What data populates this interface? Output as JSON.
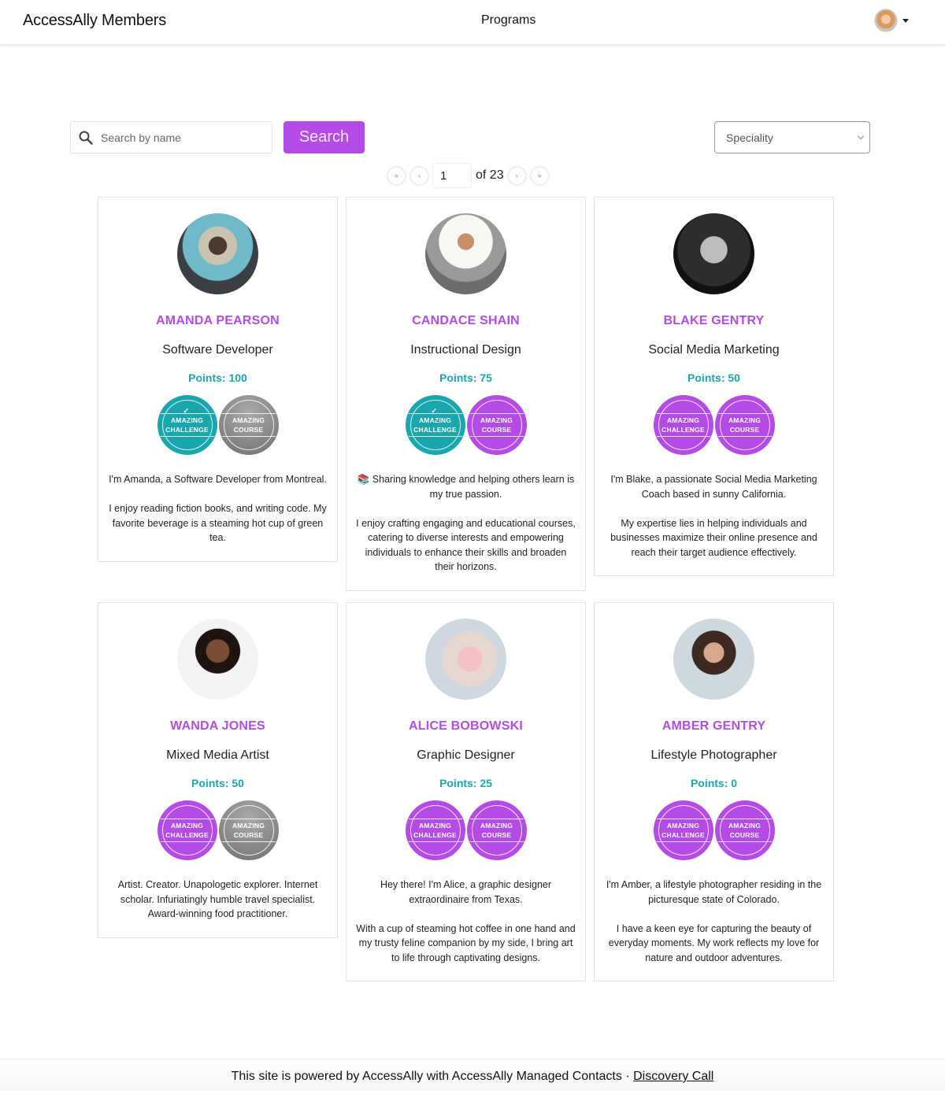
{
  "header": {
    "brand": "AccessAlly Members",
    "nav_programs": "Programs",
    "user_menu_icon": "user-avatar-dropdown"
  },
  "toolbar": {
    "search_placeholder": "Search by name",
    "search_value": "",
    "search_button": "Search",
    "speciality_selected": "Speciality"
  },
  "pagination": {
    "first_label": "«",
    "prev_label": "‹",
    "current_page": "1",
    "of_text": "of 23",
    "next_label": "›",
    "last_label": "»"
  },
  "colors": {
    "accent_purple": "#b44be6",
    "points_teal": "#1aa6ad",
    "badge_teal": "#1aa6ad",
    "badge_gray": "#8a8a8a"
  },
  "members": [
    {
      "name": "AMANDA PEARSON",
      "title": "Software Developer",
      "points": "Points: 100",
      "badges": [
        {
          "line1": "AMAZING",
          "line2": "CHALLENGE",
          "state": "completed",
          "check": "✓"
        },
        {
          "line1": "AMAZING",
          "line2": "COURSE",
          "state": "locked",
          "check": ""
        }
      ],
      "bio": [
        "I'm Amanda, a Software Developer from Montreal.",
        "I enjoy reading fiction books, and writing code. My favorite beverage is a steaming hot cup of green tea."
      ]
    },
    {
      "name": "CANDACE SHAIN",
      "title": "Instructional Design",
      "points": "Points: 75",
      "badges": [
        {
          "line1": "AMAZING",
          "line2": "CHALLENGE",
          "state": "completed",
          "check": "✓"
        },
        {
          "line1": "AMAZING",
          "line2": "COURSE",
          "state": "available",
          "check": ""
        }
      ],
      "bio": [
        "📚 Sharing knowledge and helping others learn is my true passion.",
        "I enjoy crafting engaging and educational courses, catering to diverse interests and empowering individuals to enhance their skills and broaden their horizons."
      ]
    },
    {
      "name": "BLAKE GENTRY",
      "title": "Social Media Marketing",
      "points": "Points: 50",
      "badges": [
        {
          "line1": "AMAZING",
          "line2": "CHALLENGE",
          "state": "available",
          "check": ""
        },
        {
          "line1": "AMAZING",
          "line2": "COURSE",
          "state": "available",
          "check": ""
        }
      ],
      "bio": [
        "I'm Blake, a passionate Social Media Marketing Coach based in sunny California.",
        "My expertise lies in helping individuals and businesses maximize their online presence and reach their target audience effectively."
      ]
    },
    {
      "name": "WANDA JONES",
      "title": "Mixed Media Artist",
      "points": "Points: 50",
      "badges": [
        {
          "line1": "AMAZING",
          "line2": "CHALLENGE",
          "state": "available",
          "check": ""
        },
        {
          "line1": "AMAZING",
          "line2": "COURSE",
          "state": "locked",
          "check": ""
        }
      ],
      "bio": [
        "Artist. Creator. Unapologetic explorer. Internet scholar. Infuriatingly humble travel specialist. Award-winning food practitioner."
      ]
    },
    {
      "name": "ALICE BOBOWSKI",
      "title": "Graphic Designer",
      "points": "Points: 25",
      "badges": [
        {
          "line1": "AMAZING",
          "line2": "CHALLENGE",
          "state": "available",
          "check": ""
        },
        {
          "line1": "AMAZING",
          "line2": "COURSE",
          "state": "available",
          "check": ""
        }
      ],
      "bio": [
        "Hey there! I'm Alice, a graphic designer extraordinaire from Texas.",
        "With a cup of steaming hot coffee in one hand and my trusty feline companion by my side, I bring art to life through captivating designs."
      ]
    },
    {
      "name": "AMBER GENTRY",
      "title": "Lifestyle Photographer",
      "points": "Points: 0",
      "badges": [
        {
          "line1": "AMAZING",
          "line2": "CHALLENGE",
          "state": "available",
          "check": ""
        },
        {
          "line1": "AMAZING",
          "line2": "COURSE",
          "state": "available",
          "check": ""
        }
      ],
      "bio": [
        "I'm Amber, a lifestyle photographer residing in the picturesque state of Colorado.",
        "I have a keen eye for capturing the beauty of everyday moments. My work reflects my love for nature and outdoor adventures."
      ]
    }
  ],
  "footer": {
    "text": "This site is powered by AccessAlly with AccessAlly Managed Contacts · ",
    "link": "Discovery Call"
  }
}
